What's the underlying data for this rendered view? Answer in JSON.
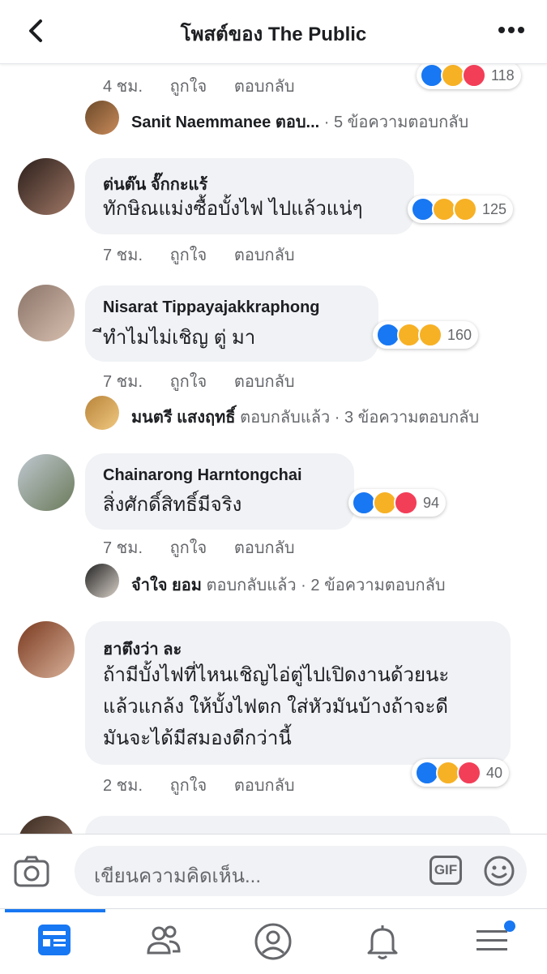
{
  "header": {
    "title": "โพสต์ของ The Public"
  },
  "common": {
    "like": "ถูกใจ",
    "reply": "ตอบกลับ"
  },
  "top_comment": {
    "time": "4 ชม.",
    "reactions": "118"
  },
  "reply_sanit": {
    "name": "Sanit Naemmanee ตอบ...",
    "tail": "· 5 ข้อความตอบกลับ"
  },
  "comments": [
    {
      "name": "ต่นต๊น จั๊กกะแร้",
      "text": "ทักษิณแม่งซื้อบั้งไฟ ไปแล้วแน่ๆ",
      "time": "7 ชม.",
      "reactions": "125"
    },
    {
      "name": "Nisarat Tippayajakkraphong",
      "text": "ีทำไมไม่เชิญ ตู่ มา",
      "time": "7 ชม.",
      "reactions": "160"
    },
    {
      "name": "Chainarong Harntongchai",
      "text": "สิ่งศักดิ์สิทธิ์มีจริง",
      "time": "7 ชม.",
      "reactions": "94"
    },
    {
      "name": "ฮาตึงว่า ละ",
      "lines": [
        "ถ้ามีบั้งไฟที่ไหนเชิญไอ่ตู่ไปเปิดงานด้วยนะ",
        "แล้วแกล้ง ให้บั้งไฟตก ใส่หัวมันบ้างถ้าจะดี",
        "มันจะได้มีสมองดีกว่านี้"
      ],
      "time": "2 ชม.",
      "reactions": "40"
    }
  ],
  "replies": [
    {
      "name": "มนตรี แสงฤทธิ์",
      "suffix": "ตอบกลับแล้ว",
      "tail": "· 3 ข้อความตอบกลับ"
    },
    {
      "name": "จำใจ ยอม",
      "suffix": "ตอบกลับแล้ว",
      "tail": "· 2 ข้อความตอบกลับ"
    }
  ],
  "composer": {
    "placeholder": "เขียนความคิดเห็น...",
    "gif_label": "GIF"
  },
  "icons": [
    "back-arrow-icon",
    "more-icon",
    "camera-icon",
    "gif-icon",
    "smiley-icon",
    "news-feed-icon",
    "friends-icon",
    "profile-icon",
    "bell-icon",
    "menu-icon"
  ],
  "colors": {
    "accent": "#1877f2",
    "like": "#1877f2",
    "love": "#f33e58",
    "haha": "#f7b125"
  }
}
